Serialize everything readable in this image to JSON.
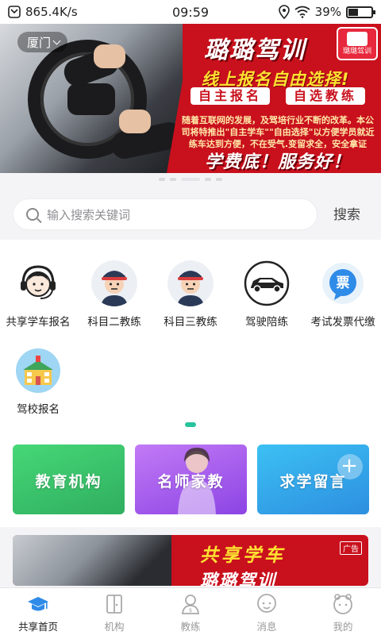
{
  "status_bar": {
    "speed": "865.4K/s",
    "time": "09:59",
    "battery_percent": "39%",
    "battery_level": 0.39
  },
  "banner": {
    "city": "厦门",
    "brand": "璐璐驾训",
    "logo_text": "璐璐驾训",
    "headline": "线上报名自由选择!",
    "pill_left": "自主报名",
    "pill_right": "自选教练",
    "body": "随着互联网的发展，及驾培行业不断的改革。本公司将特推出\"自主学车\"\"自由选择\"以方便学员就近练车达到方便，不在受气.变留求全，安全拿证",
    "slogan": "学费底！服务好！",
    "slide_count": 5,
    "active_slide": 2
  },
  "search": {
    "placeholder": "输入搜索关键词",
    "button_label": "搜索"
  },
  "services": [
    {
      "label": "共享学车报名",
      "icon": "customer-service-icon"
    },
    {
      "label": "科目二教练",
      "icon": "coach-icon"
    },
    {
      "label": "科目三教练",
      "icon": "coach-icon"
    },
    {
      "label": "驾驶陪练",
      "icon": "car-icon"
    },
    {
      "label": "考试发票代缴",
      "icon": "ticket-icon"
    },
    {
      "label": "驾校报名",
      "icon": "school-icon"
    }
  ],
  "cards": [
    {
      "label": "教育机构",
      "color": "#3ecb6f"
    },
    {
      "label": "名师家教",
      "color": "#a55cf0"
    },
    {
      "label": "求学留言",
      "color": "#2fa7e8"
    }
  ],
  "ad": {
    "title": "共享学车",
    "brand": "璐璐驾训",
    "tag": "广告"
  },
  "tabbar": [
    {
      "label": "共享首页",
      "icon": "graduation-cap-icon",
      "active": true
    },
    {
      "label": "机构",
      "icon": "building-icon",
      "active": false
    },
    {
      "label": "教练",
      "icon": "person-icon",
      "active": false
    },
    {
      "label": "消息",
      "icon": "message-icon",
      "active": false
    },
    {
      "label": "我的",
      "icon": "profile-icon",
      "active": false
    }
  ],
  "colors": {
    "brand_red": "#c9101d",
    "accent_green": "#27c39c",
    "tab_active": "#2f8be8"
  }
}
